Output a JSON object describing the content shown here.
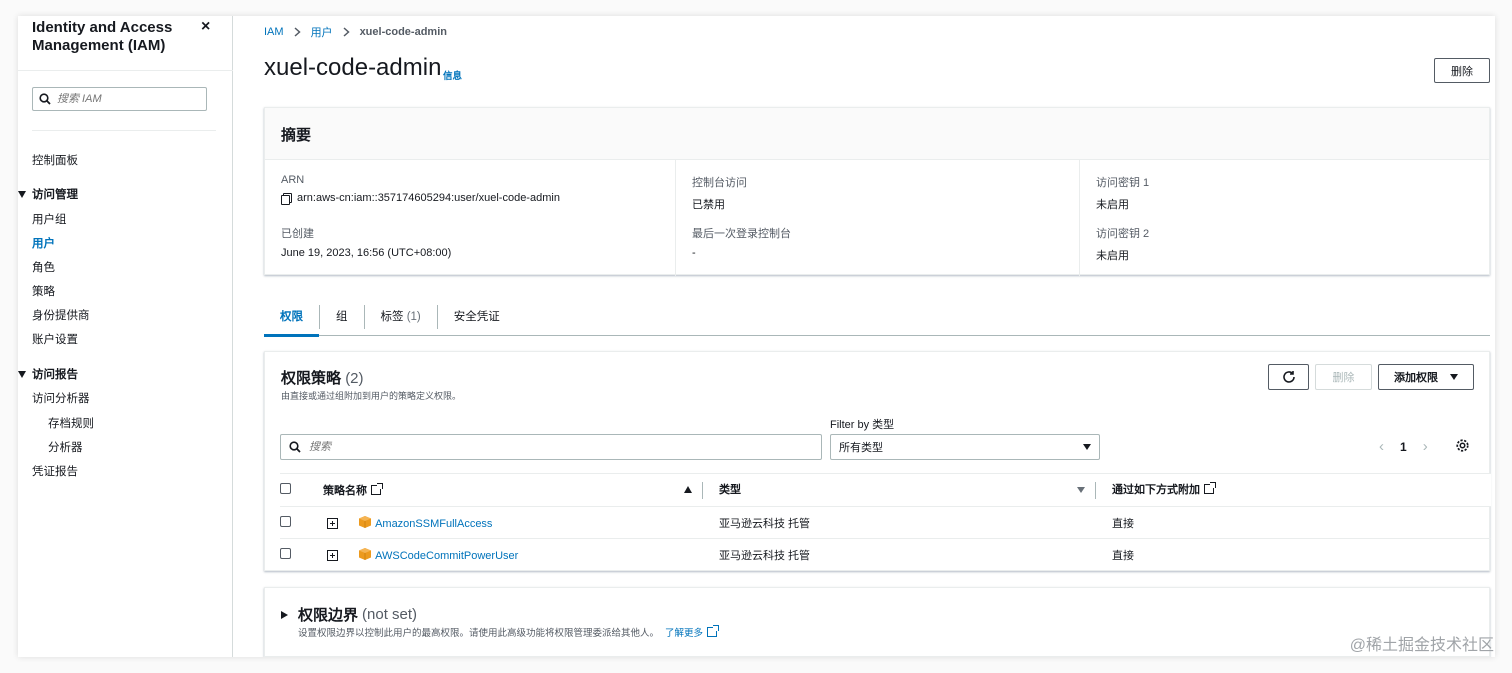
{
  "sidebar": {
    "title": "Identity and Access Management (IAM)",
    "close_icon": "×",
    "search_placeholder": "搜索 IAM",
    "dashboard": "控制面板",
    "access_management": {
      "label": "访问管理",
      "items": [
        {
          "label": "用户组",
          "active": false
        },
        {
          "label": "用户",
          "active": true
        },
        {
          "label": "角色",
          "active": false
        },
        {
          "label": "策略",
          "active": false
        },
        {
          "label": "身份提供商",
          "active": false
        },
        {
          "label": "账户设置",
          "active": false
        }
      ]
    },
    "access_reports": {
      "label": "访问报告",
      "analyzer": "访问分析器",
      "archive_rules": "存档规则",
      "analyzers": "分析器",
      "credential_report": "凭证报告"
    }
  },
  "breadcrumb": {
    "iam": "IAM",
    "users": "用户",
    "current": "xuel-code-admin"
  },
  "header": {
    "title": "xuel-code-admin",
    "info": "信息",
    "delete": "删除"
  },
  "summary": {
    "title": "摘要",
    "arn_label": "ARN",
    "arn_value": "arn:aws-cn:iam::357174605294:user/xuel-code-admin",
    "created_label": "已创建",
    "created_value": "June 19, 2023, 16:56 (UTC+08:00)",
    "console_access_label": "控制台访问",
    "console_access_value": "已禁用",
    "last_login_label": "最后一次登录控制台",
    "last_login_value": "-",
    "key1_label": "访问密钥 1",
    "key1_value": "未启用",
    "key2_label": "访问密钥 2",
    "key2_value": "未启用"
  },
  "tabs": [
    {
      "label": "权限",
      "count": "",
      "active": true
    },
    {
      "label": "组",
      "count": "",
      "active": false
    },
    {
      "label": "标签",
      "count": "(1)",
      "active": false
    },
    {
      "label": "安全凭证",
      "count": "",
      "active": false
    }
  ],
  "policies": {
    "title": "权限策略",
    "count": "(2)",
    "subtitle": "由直接或通过组附加到用户的策略定义权限。",
    "delete": "删除",
    "add_permissions": "添加权限",
    "filter_label": "Filter by 类型",
    "search_placeholder": "搜索",
    "type_select": "所有类型",
    "page": "1",
    "columns": {
      "name": "策略名称",
      "type": "类型",
      "attached": "通过如下方式附加"
    },
    "rows": [
      {
        "name": "AmazonSSMFullAccess",
        "type": "亚马逊云科技 托管",
        "attached": "直接"
      },
      {
        "name": "AWSCodeCommitPowerUser",
        "type": "亚马逊云科技 托管",
        "attached": "直接"
      }
    ]
  },
  "boundary": {
    "title": "权限边界",
    "status": "(not set)",
    "description": "设置权限边界以控制此用户的最高权限。请使用此高级功能将权限管理委派给其他人。",
    "learn_more": "了解更多"
  },
  "watermark": "@稀土掘金技术社区",
  "colors": {
    "link": "#0073bb",
    "border": "#aab7b8",
    "policy_icon": "#ec9a1e"
  }
}
